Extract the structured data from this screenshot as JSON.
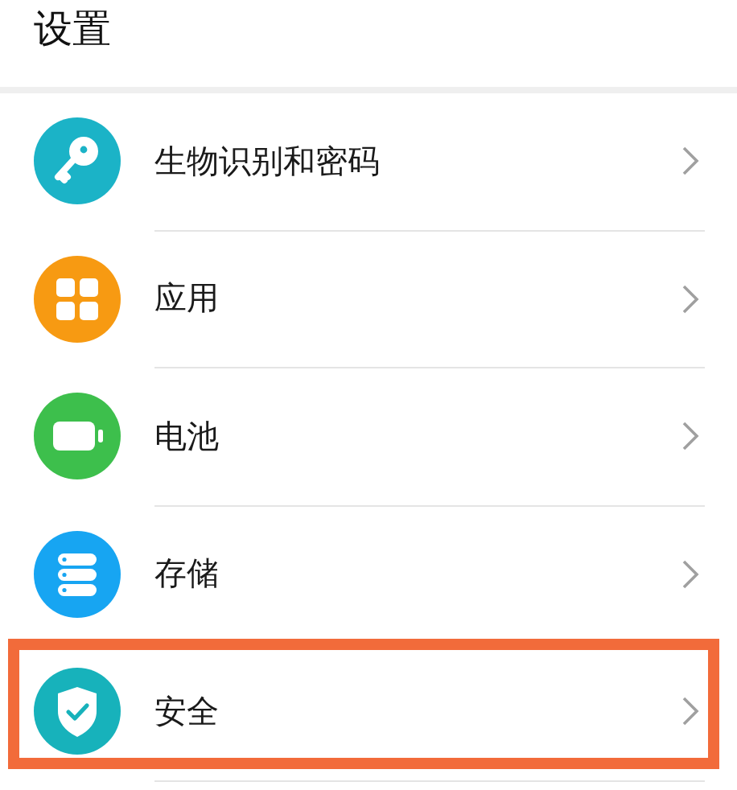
{
  "title": "设置",
  "rows": [
    {
      "label": "生物识别和密码",
      "kind": "key",
      "color": "#1bb3c7",
      "highlighted": false
    },
    {
      "label": "应用",
      "kind": "grid",
      "color": "#f79a12",
      "highlighted": false
    },
    {
      "label": "电池",
      "kind": "battery",
      "color": "#3dbf4c",
      "highlighted": false
    },
    {
      "label": "存储",
      "kind": "storage",
      "color": "#17a5f2",
      "highlighted": false
    },
    {
      "label": "安全",
      "kind": "shield",
      "color": "#17b2bb",
      "highlighted": true
    }
  ]
}
